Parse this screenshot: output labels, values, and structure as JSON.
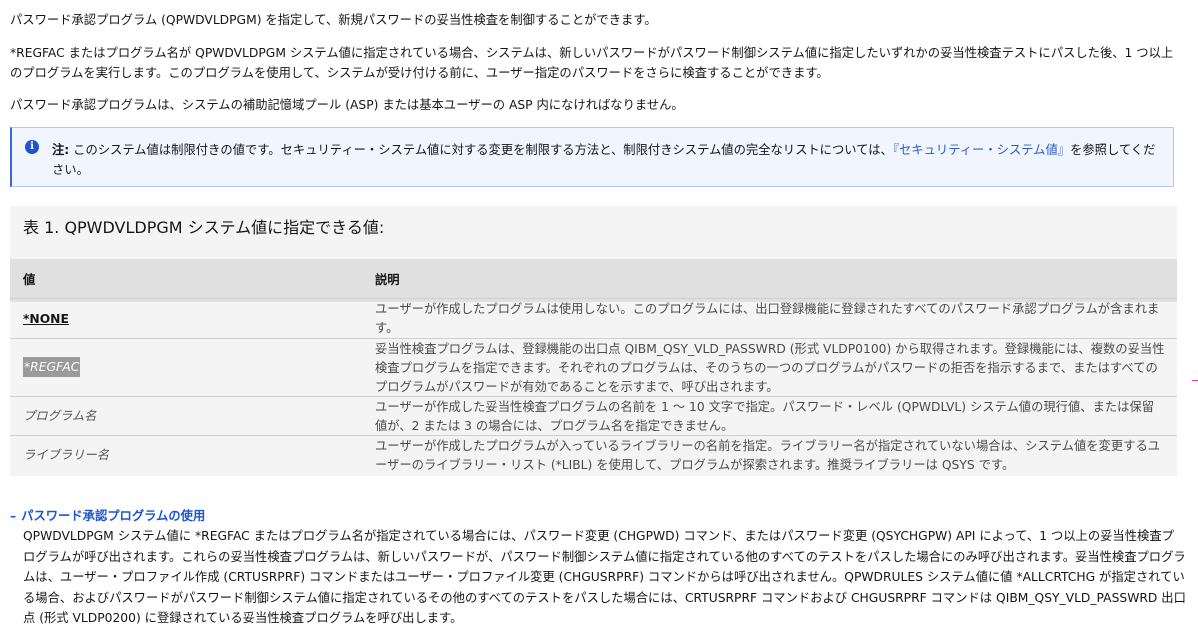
{
  "intro": {
    "p1": "パスワード承認プログラム (QPWDVLDPGM) を指定して、新規パスワードの妥当性検査を制御することができます。",
    "p2": "*REGFAC またはプログラム名が QPWDVLDPGM システム値に指定されている場合、システムは、新しいパスワードがパスワード制御システム値に指定したいずれかの妥当性検査テストにパスした後、1 つ以上のプログラムを実行します。このプログラムを使用して、システムが受け付ける前に、ユーザー指定のパスワードをさらに検査することができます。",
    "p3": "パスワード承認プログラムは、システムの補助記憶域プール (ASP) または基本ユーザーの ASP 内になければなりません。"
  },
  "note": {
    "icon": "info-icon",
    "label": "注:",
    "text_before": "このシステム値は制限付きの値です。セキュリティー・システム値に対する変更を制限する方法と、制限付きシステム値の完全なリストについては、",
    "link": "『セキュリティー・システム値』",
    "text_after": "を参照してください。"
  },
  "table": {
    "caption": "表 1. QPWDVLDPGM システム値に指定できる値:",
    "headers": {
      "value": "値",
      "description": "説明"
    },
    "rows": [
      {
        "value": "*NONE",
        "description": "ユーザーが作成したプログラムは使用しない。このプログラムには、出口登録機能に登録されたすべてのパスワード承認プログラムが含まれます。"
      },
      {
        "value": "*REGFAC",
        "description": "妥当性検査プログラムは、登録機能の出口点 QIBM_QSY_VLD_PASSWRD (形式 VLDP0100) から取得されます。登録機能には、複数の妥当性検査プログラムを指定できます。それぞれのプログラムは、そのうちの一つのプログラムがパスワードの拒否を指示するまで、またはすべてのプログラムがパスワードが有効であることを示すまで、呼び出されます。"
      },
      {
        "value": "プログラム名",
        "description": "ユーザーが作成した妥当性検査プログラムの名前を 1 〜 10 文字で指定。パスワード・レベル (QPWDLVL) システム値の現行値、または保留値が、2 または 3 の場合には、プログラム名を指定できません。"
      },
      {
        "value": "ライブラリー名",
        "description": "ユーザーが作成したプログラムが入っているライブラリーの名前を指定。ライブラリー名が指定されていない場合は、システム値を変更するユーザーのライブラリー・リスト (*LIBL) を使用して、プログラムが探索されます。推奨ライブラリーは QSYS です。"
      }
    ]
  },
  "section": {
    "toggle": "–",
    "title": "パスワード承認プログラムの使用",
    "body": "QPWDVLDPGM システム値に *REGFAC またはプログラム名が指定されている場合には、パスワード変更 (CHGPWD) コマンド、またはパスワード変更 (QSYCHGPW) API によって、1 つ以上の妥当性検査プログラムが呼び出されます。これらの妥当性検査プログラムは、新しいパスワードが、パスワード制御システム値に指定されている他のすべてのテストをパスした場合にのみ呼び出されます。妥当性検査プログラムは、ユーザー・プロファイル作成 (CRTUSRPRF) コマンドまたはユーザー・プロファイル変更 (CHGUSRPRF) コマンドからは呼び出されません。QPWDRULES システム値に値 *ALLCRTCHG が指定されている場合、およびパスワードがパスワード制御システム値に指定されているその他のすべてのテストをパスした場合には、CRTUSRPRF コマンドおよび CHGUSRPRF コマンドは QIBM_QSY_VLD_PASSWRD 出口点 (形式 VLDP0200) に登録されている妥当性検査プログラムを呼び出します。"
  },
  "colors": {
    "link": "#1f55cc",
    "note_bg": "#f0f5ff",
    "table_bg": "#f4f4f4",
    "header_bg": "#e0e0e0"
  }
}
